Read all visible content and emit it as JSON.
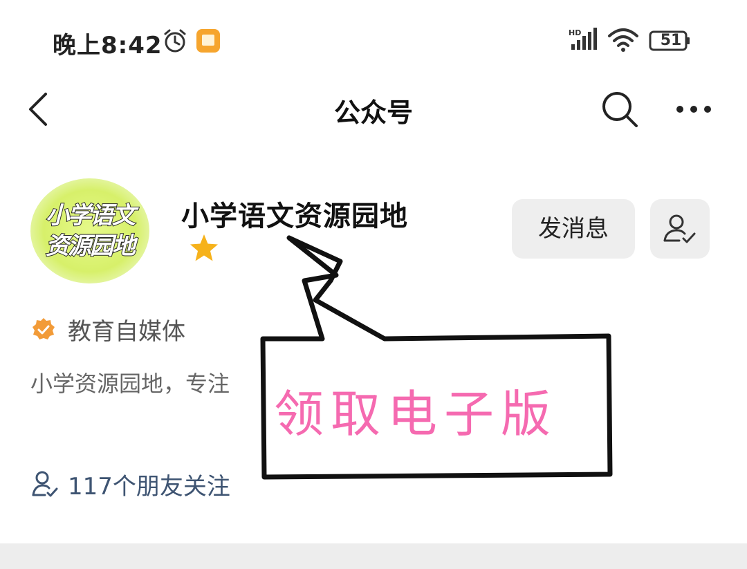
{
  "status_bar": {
    "time": "晚上8:42",
    "battery": "51",
    "network_badge": "HD"
  },
  "nav": {
    "title": "公众号"
  },
  "account": {
    "avatar_lines": [
      "小学语文",
      "资源园地"
    ],
    "name": "小学语文资源园地",
    "verified_label": "教育自媒体",
    "description": "小学资源园地，专注",
    "friends_following": "117个朋友关注"
  },
  "actions": {
    "message_label": "发消息"
  },
  "overlay": {
    "callout_text": "领取电子版"
  },
  "colors": {
    "star": "#f6b21b",
    "verified_badge": "#f29b38",
    "callout_text": "#f56ab0",
    "button_bg": "#eeeeee"
  }
}
